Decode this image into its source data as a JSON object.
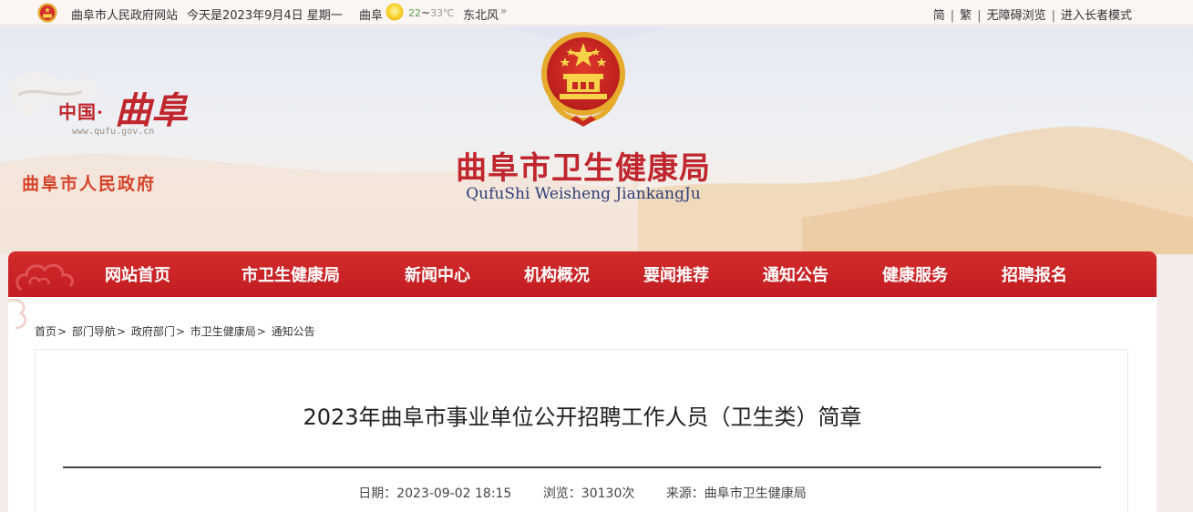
{
  "topbar": {
    "site_name": "曲阜市人民政府网站",
    "date_text": "今天是2023年9月4日 星期一",
    "city": "曲阜",
    "temp_low": "22",
    "temp_sep": "~",
    "temp_high": "33℃",
    "wind": "东北风",
    "wind_arrow": "»",
    "links": [
      "简",
      "繁",
      "无障碍浏览",
      "进入长者模式"
    ]
  },
  "banner": {
    "logo_cn": "中国·",
    "logo_script": "曲阜",
    "logo_url": "www.qufu.gov.cn",
    "logo_gov": "曲阜市人民政府",
    "title_cn": "曲阜市卫生健康局",
    "title_en": "QufuShi Weisheng JiankangJu"
  },
  "nav": {
    "items": [
      "网站首页",
      "市卫生健康局",
      "新闻中心",
      "机构概况",
      "要闻推荐",
      "通知公告",
      "健康服务",
      "招聘报名"
    ]
  },
  "breadcrumb": {
    "items": [
      "首页",
      "部门导航",
      "政府部门",
      "市卫生健康局",
      "通知公告"
    ],
    "separator": ">"
  },
  "article": {
    "title": "2023年曲阜市事业单位公开招聘工作人员（卫生类）简章",
    "date_label": "日期：2023-09-02 18:15",
    "views_label": "浏览：30130次",
    "source_label": "来源：曲阜市卫生健康局"
  },
  "colors": {
    "brand_red": "#c0262d",
    "nav_red": "#c21d22",
    "title_blue": "#2c3f7a",
    "gov_orange": "#d6432a"
  },
  "icons": [
    "national-emblem-icon",
    "sun-icon",
    "double-chevron-icon",
    "cloud-pattern-icon"
  ]
}
